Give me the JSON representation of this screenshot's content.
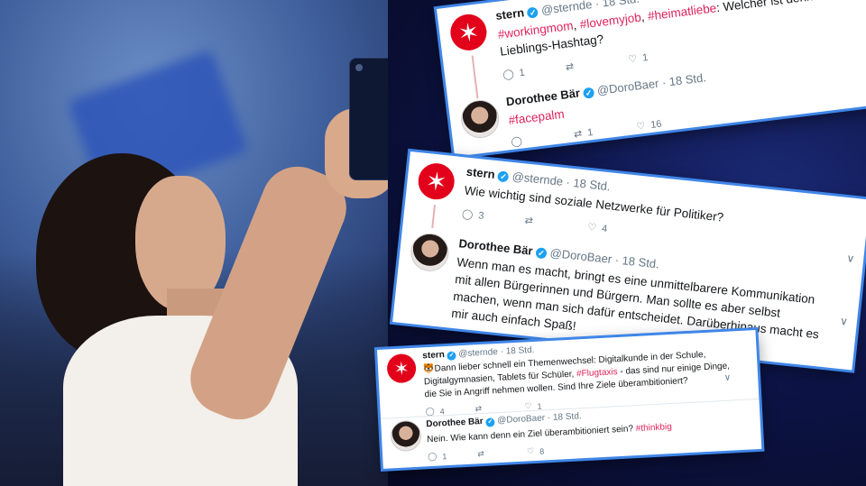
{
  "tweets": {
    "t1": {
      "name": "stern",
      "handle": "@sternde",
      "time": "18 Std.",
      "hashtags": [
        "#workingmom",
        "#lovemyjob",
        "#heimatliebe"
      ],
      "text_after": ": Welcher ist denn nun Ihr Lieblings-Hashtag?",
      "replies": "1",
      "likes": "1"
    },
    "t2": {
      "name": "Dorothee Bär",
      "handle": "@DoroBaer",
      "time": "18 Std.",
      "text": "#facepalm",
      "retweets": "1",
      "likes": "16"
    },
    "t3": {
      "name": "stern",
      "handle": "@sternde",
      "time": "18 Std.",
      "text": "Wie wichtig sind soziale Netzwerke für Politiker?",
      "replies": "3",
      "likes": "4"
    },
    "t4": {
      "name": "Dorothee Bär",
      "handle": "@DoroBaer",
      "time": "18 Std.",
      "text": "Wenn man es macht, bringt es eine unmittelbarere Kommunikation mit allen Bürgerinnen und Bürgern. Man sollte es aber selbst machen, wenn man sich dafür entscheidet. Darüberhinaus macht es mir auch einfach Spaß!"
    },
    "t5": {
      "name": "stern",
      "handle": "@sternde",
      "time": "18 Std.",
      "text_before": "Dann lieber schnell ein Themenwechsel: Digitalkunde in der Schule, Digitalgymnasien, Tablets für Schüler, ",
      "hashtag": "#Flugtaxis",
      "text_after": " - das sind nur einige Dinge, die Sie in Angriff nehmen wollen. Sind Ihre Ziele überambitioniert?",
      "replies": "4",
      "likes": "1"
    },
    "t6": {
      "name": "Dorothee Bär",
      "handle": "@DoroBaer",
      "time": "18 Std.",
      "text_before": "Nein. Wie kann denn ein Ziel überambitioniert sein? ",
      "hashtag": "#thinkbig",
      "replies": "1",
      "likes": "8"
    }
  },
  "icons": {
    "stern_logo": "star-icon",
    "verified": "verified-badge-icon",
    "reply": "reply-icon",
    "retweet": "retweet-icon",
    "like": "heart-icon",
    "more": "chevron-down-icon"
  },
  "colors": {
    "stern_red": "#e2001a",
    "verified_blue": "#1da1f2",
    "hashtag": "#e0245e",
    "card_border": "#3f86e8"
  },
  "glyphs": {
    "sep": "·",
    "check": "✓",
    "star": "✶",
    "reply": "◯",
    "retweet": "⇄",
    "like": "♡",
    "chev": "∨",
    "emoji": "🐯",
    "comma": ", "
  }
}
